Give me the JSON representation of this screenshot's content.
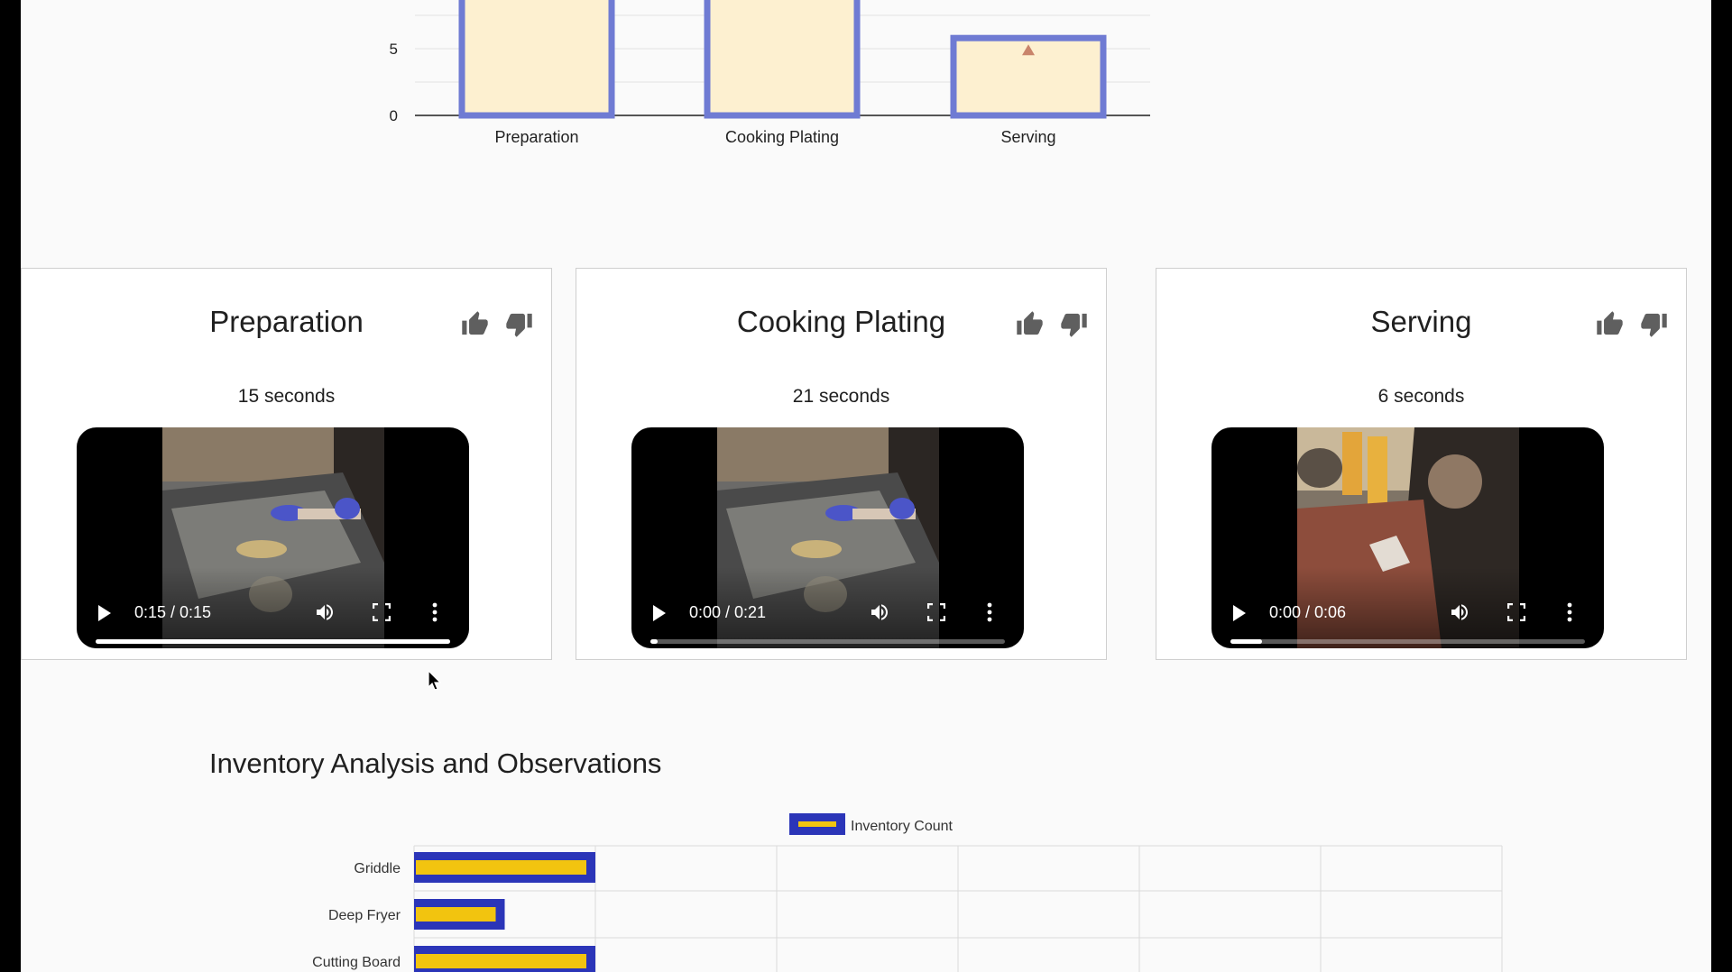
{
  "top_chart": {
    "chart_data": {
      "type": "bar",
      "categories": [
        "Preparation",
        "Cooking Plating",
        "Serving"
      ],
      "values": [
        15,
        21,
        6
      ],
      "y_ticks": [
        "0",
        "5"
      ],
      "ylim": [
        0,
        8.6
      ],
      "colors": {
        "fill": "#fdf0d0",
        "border": "#6f7bd3",
        "marker": "#c9846b"
      },
      "grid": true
    }
  },
  "cards": [
    {
      "title": "Preparation",
      "duration": "15 seconds",
      "time": "0:15 / 0:15",
      "progress": 1.0,
      "scene": "kitchen-griddle"
    },
    {
      "title": "Cooking Plating",
      "duration": "21 seconds",
      "time": "0:00 / 0:21",
      "progress": 0.02,
      "scene": "kitchen-griddle"
    },
    {
      "title": "Serving",
      "duration": "6 seconds",
      "time": "0:00 / 0:06",
      "progress": 0.09,
      "scene": "kitchen-counter"
    }
  ],
  "icons": {
    "like": "thumbs-up-icon",
    "dislike": "thumbs-down-icon",
    "play": "play-icon",
    "volume": "volume-icon",
    "fullscreen": "fullscreen-icon",
    "more": "more-vert-icon"
  },
  "inventory": {
    "title": "Inventory Analysis and Observations",
    "chart_data": {
      "type": "bar",
      "orientation": "horizontal",
      "legend": "Inventory Count",
      "legend_position": "top",
      "categories": [
        "Griddle",
        "Deep Fryer",
        "Cutting Board"
      ],
      "values": [
        1,
        0.5,
        1
      ],
      "xlim": [
        0,
        6
      ],
      "grid": true,
      "colors": {
        "fill": "#f2c40f",
        "border": "#2b35b8"
      }
    }
  }
}
